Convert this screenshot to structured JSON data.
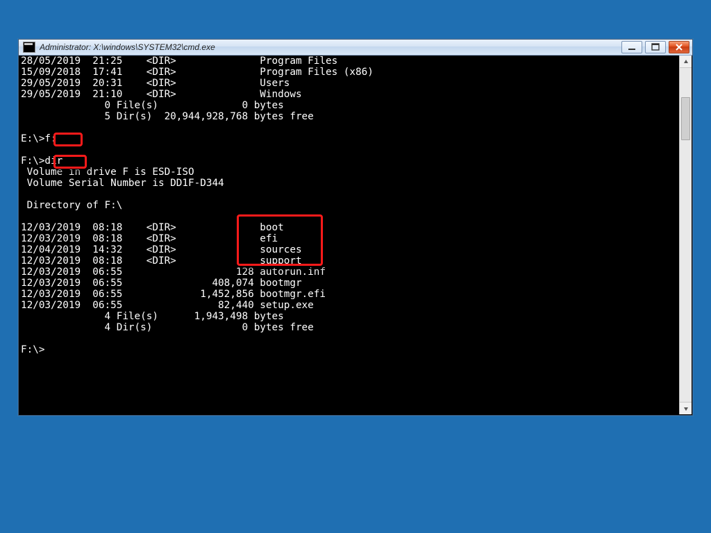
{
  "window": {
    "title": "Administrator: X:\\windows\\SYSTEM32\\cmd.exe"
  },
  "highlights": {
    "cmd1": "f:",
    "cmd2": "dir",
    "dirs": [
      "boot",
      "efi",
      "sources",
      "support"
    ]
  },
  "console": {
    "top_listing": {
      "rows": [
        {
          "date": "28/05/2019",
          "time": "21:25",
          "type": "<DIR>",
          "size": "",
          "name": "Program Files"
        },
        {
          "date": "15/09/2018",
          "time": "17:41",
          "type": "<DIR>",
          "size": "",
          "name": "Program Files (x86)"
        },
        {
          "date": "29/05/2019",
          "time": "20:31",
          "type": "<DIR>",
          "size": "",
          "name": "Users"
        },
        {
          "date": "29/05/2019",
          "time": "21:10",
          "type": "<DIR>",
          "size": "",
          "name": "Windows"
        }
      ],
      "summary_files": "0 File(s)              0 bytes",
      "summary_dirs": "5 Dir(s)  20,944,928,768 bytes free"
    },
    "prompt1_drive": "E:\\",
    "prompt1_cmd": "f:",
    "prompt2_drive": "F:\\",
    "prompt2_cmd": "dir",
    "volume_line": " Volume in drive F is ESD-ISO",
    "serial_line": " Volume Serial Number is DD1F-D344",
    "dirof_line": " Directory of F:\\",
    "f_listing": {
      "rows": [
        {
          "date": "12/03/2019",
          "time": "08:18",
          "type": "<DIR>",
          "size": "",
          "name": "boot"
        },
        {
          "date": "12/03/2019",
          "time": "08:18",
          "type": "<DIR>",
          "size": "",
          "name": "efi"
        },
        {
          "date": "12/04/2019",
          "time": "14:32",
          "type": "<DIR>",
          "size": "",
          "name": "sources"
        },
        {
          "date": "12/03/2019",
          "time": "08:18",
          "type": "<DIR>",
          "size": "",
          "name": "support"
        },
        {
          "date": "12/03/2019",
          "time": "06:55",
          "type": "",
          "size": "128",
          "name": "autorun.inf"
        },
        {
          "date": "12/03/2019",
          "time": "06:55",
          "type": "",
          "size": "408,074",
          "name": "bootmgr"
        },
        {
          "date": "12/03/2019",
          "time": "06:55",
          "type": "",
          "size": "1,452,856",
          "name": "bootmgr.efi"
        },
        {
          "date": "12/03/2019",
          "time": "06:55",
          "type": "",
          "size": "82,440",
          "name": "setup.exe"
        }
      ],
      "summary_files": "4 File(s)      1,943,498 bytes",
      "summary_dirs": "4 Dir(s)               0 bytes free"
    },
    "final_prompt": "F:\\>"
  }
}
